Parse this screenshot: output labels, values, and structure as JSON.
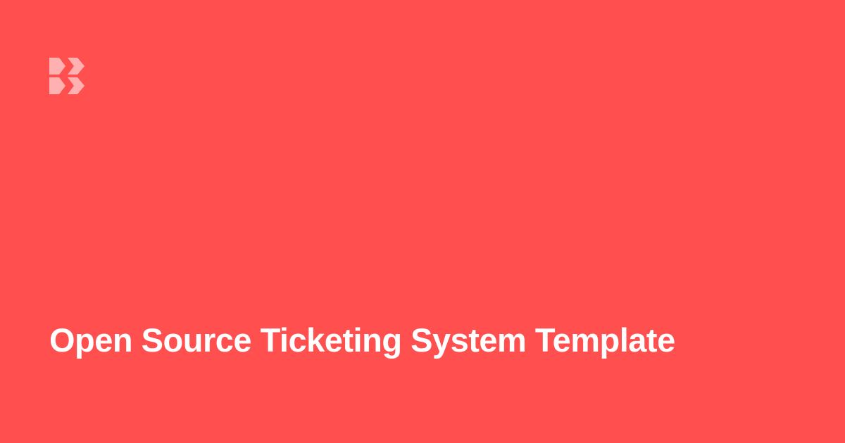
{
  "colors": {
    "background": "#FF4F4F",
    "logo": "#FFB0B0",
    "title_text": "#FFFFFF"
  },
  "logo": {
    "icon": "brand-logo-icon"
  },
  "title": "Open Source Ticketing System Template"
}
